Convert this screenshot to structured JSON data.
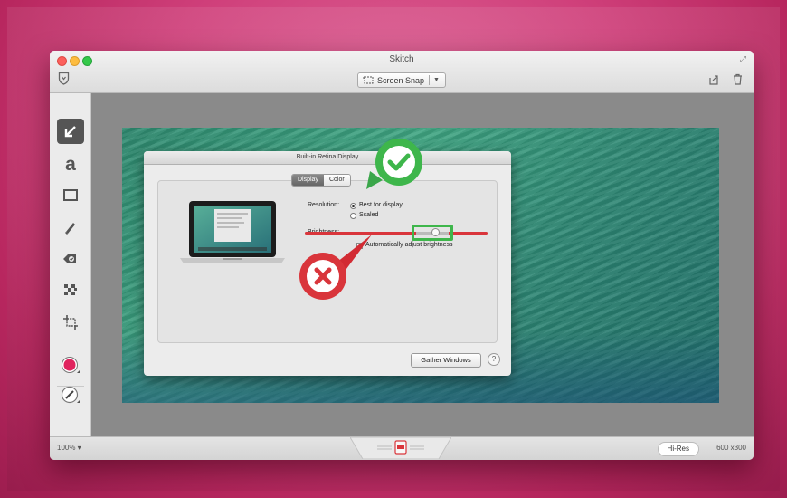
{
  "window": {
    "title": "Skitch"
  },
  "toolbar_top": {
    "snap_label": "Screen Snap"
  },
  "tools": [
    {
      "name": "arrow-tool"
    },
    {
      "name": "text-tool",
      "glyph": "a"
    },
    {
      "name": "rectangle-tool"
    },
    {
      "name": "marker-tool"
    },
    {
      "name": "stamp-tool"
    },
    {
      "name": "pixelate-tool"
    },
    {
      "name": "crop-tool"
    }
  ],
  "colors": {
    "accent_red": "#d9353b",
    "check_green": "#3eb64b",
    "color_well": "#e0245e"
  },
  "dialog": {
    "title": "Built-in Retina Display",
    "tabs": [
      "Display",
      "Color"
    ],
    "selected_tab": "Display",
    "resolution_label": "Resolution:",
    "resolution_options": [
      "Best for display",
      "Scaled"
    ],
    "brightness_label": "Brightness:",
    "auto_brightness_label": "Automatically adjust brightness",
    "gather_button": "Gather Windows",
    "help": "?"
  },
  "status": {
    "zoom": "100% ▾",
    "hires": "Hi-Res",
    "dimensions": "600 x300"
  }
}
